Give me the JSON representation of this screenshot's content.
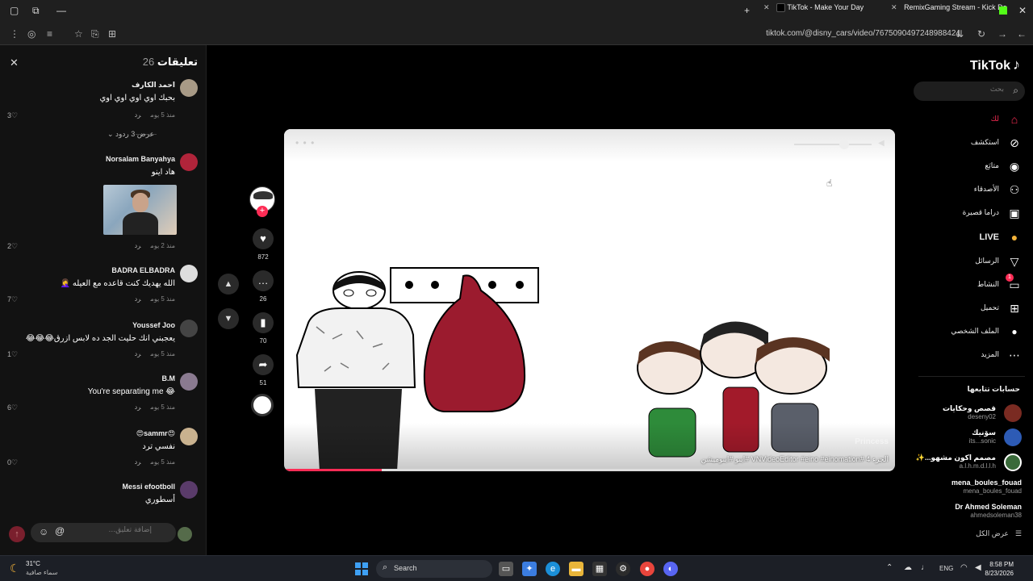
{
  "browser": {
    "tabs": [
      {
        "label": "TikTok - Make Your Day",
        "active": true
      },
      {
        "label": "RemixGaming Stream - Kick Da",
        "active": false
      }
    ],
    "url": "tiktok.com/@disny_cars/video/7675090497248988424"
  },
  "comments": {
    "title": "تعليقات",
    "count": "26",
    "items": [
      {
        "author": "احمد الكارف",
        "text": "بحبك اوي اوي اوي اوي",
        "time": "منذ 5 يوم",
        "reply": "رد",
        "likes": "3"
      },
      {
        "author": "Norsalam Banyahya",
        "text": "هاد اينو",
        "time": "منذ 2 يوم",
        "reply": "رد",
        "likes": "2"
      },
      {
        "author": "BADRA ELBADRA",
        "text": "الله يهديك كنت قاعده مع العيله 🤦‍♀️",
        "time": "منذ 5 يوم",
        "reply": "رد",
        "likes": "7"
      },
      {
        "author": "Youssef Joo",
        "text": "يعجبني انك حليت الجد ده لابس ازرق😂😂😂",
        "time": "منذ 5 يوم",
        "reply": "رد",
        "likes": "1"
      },
      {
        "author": "B.M",
        "text": "😂 You're separating me",
        "time": "منذ 5 يوم",
        "reply": "رد",
        "likes": "6"
      },
      {
        "author": "😍sammr😍",
        "text": "نفسي ترد",
        "time": "منذ 5 يوم",
        "reply": "رد",
        "likes": "0"
      },
      {
        "author": "Messi efootboll",
        "text": "أسطوري",
        "time": "",
        "reply": "",
        "likes": ""
      }
    ],
    "replies_toggle": "عرض 3 ردود",
    "input_placeholder": "إضافة تعليق..."
  },
  "actions": {
    "likes": "872",
    "comments": "26",
    "saves": "70",
    "shares": "51"
  },
  "video": {
    "caption": "الجزء 4 #VNVideoEditor #eino #einomation #اينو #اينوميشن",
    "watermark": "Princess",
    "progress": 0.16
  },
  "sidebar": {
    "logo": "TikTok",
    "search_placeholder": "بحث",
    "nav": [
      {
        "label": "لك",
        "icon": "home-icon",
        "active": true
      },
      {
        "label": "استكشف",
        "icon": "compass-icon"
      },
      {
        "label": "متابَع",
        "icon": "following-icon"
      },
      {
        "label": "الأصدقاء",
        "icon": "friends-icon"
      },
      {
        "label": "دراما قصيرة",
        "icon": "drama-icon"
      },
      {
        "label": "LIVE",
        "icon": "live-icon"
      },
      {
        "label": "الرسائل",
        "icon": "messages-icon"
      },
      {
        "label": "النشاط",
        "icon": "activity-icon",
        "badge": "1"
      },
      {
        "label": "تحميل",
        "icon": "upload-icon"
      },
      {
        "label": "الملف الشخصي",
        "icon": "profile-icon"
      },
      {
        "label": "المزيد",
        "icon": "more-icon"
      }
    ],
    "following_title": "حسابات تتابعها",
    "following": [
      {
        "name": "قصص وحكايات",
        "handle": "deseny02"
      },
      {
        "name": "سۆنيك",
        "handle": "its...sonic"
      },
      {
        "name": "مصمم اكون مشهو...✨",
        "handle": "a.l.h.m.d.l.l.h"
      },
      {
        "name": "mena_boules_fouad",
        "handle": "mena_boules_fouad"
      },
      {
        "name": "Dr Ahmed Soleman",
        "handle": "ahmedsoleman38"
      }
    ],
    "see_all": "عرض الكل"
  },
  "taskbar": {
    "weather_temp": "31°C",
    "weather_desc": "سماء صافية",
    "search_label": "Search",
    "lang": "ENG",
    "time": "8:58 PM",
    "date": "8/23/2026"
  }
}
